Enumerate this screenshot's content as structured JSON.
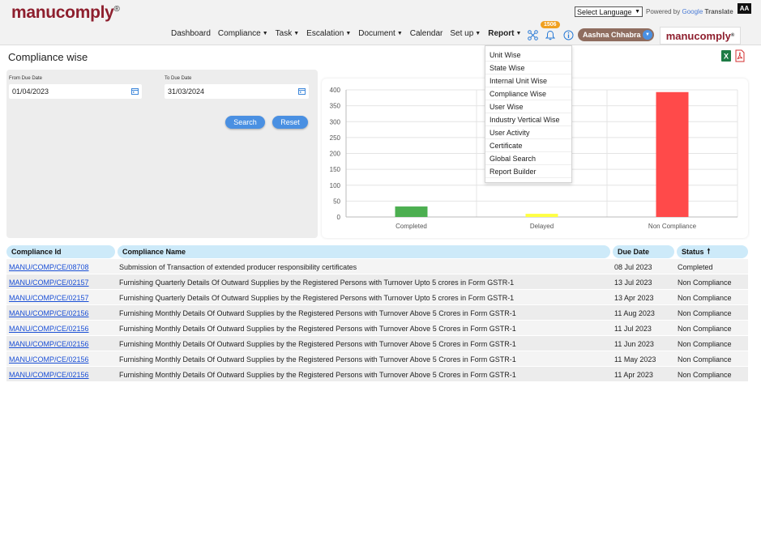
{
  "header": {
    "logo": "manucomply",
    "logo_reg": "®",
    "language_select": "Select Language",
    "powered_by": "Powered by",
    "google": "Google",
    "translate": "Translate",
    "aa": "AA",
    "notification_count": "1506",
    "user_name": "Aashna Chhabra",
    "brand_logo": "manucomply"
  },
  "nav": {
    "items": [
      {
        "label": "Dashboard"
      },
      {
        "label": "Compliance"
      },
      {
        "label": "Task"
      },
      {
        "label": "Escalation"
      },
      {
        "label": "Document"
      },
      {
        "label": "Calendar"
      },
      {
        "label": "Set up"
      },
      {
        "label": "Report"
      }
    ]
  },
  "icons": {
    "network": "network-icon",
    "bell": "bell-icon",
    "info": "info-icon",
    "excel": "excel-icon",
    "pdf": "pdf-icon",
    "calendar": "calendar-icon"
  },
  "page": {
    "title": "Compliance wise"
  },
  "filters": {
    "from_label": "From Due Date",
    "from_value": "01/04/2023",
    "to_label": "To Due Date",
    "to_value": "31/03/2024",
    "search_label": "Search",
    "reset_label": "Reset"
  },
  "report_menu": {
    "items": [
      "Unit Wise",
      "State Wise",
      "Internal Unit Wise",
      "Compliance Wise",
      "User Wise",
      "Industry Vertical Wise",
      "User Activity",
      "Certificate",
      "Global Search",
      "Report Builder"
    ]
  },
  "chart_data": {
    "type": "bar",
    "categories": [
      "Completed",
      "Delayed",
      "Non Compliance"
    ],
    "values": [
      33,
      10,
      393
    ],
    "colors": [
      "#4caf50",
      "#ffff44",
      "#ff4a4a"
    ],
    "ylim": [
      0,
      400
    ],
    "yticks": [
      0,
      50,
      100,
      150,
      200,
      250,
      300,
      350,
      400
    ],
    "grid": true
  },
  "table": {
    "headers": {
      "id": "Compliance Id",
      "name": "Compliance Name",
      "due": "Due Date",
      "status": "Status",
      "sort_arrow": "🠕"
    },
    "rows": [
      {
        "id": "MANU/COMP/CE/08708",
        "name": "Submission of Transaction of extended producer responsibility certificates",
        "due": "08 Jul 2023",
        "status": "Completed"
      },
      {
        "id": "MANU/COMP/CE/02157",
        "name": "Furnishing Quarterly Details Of Outward Supplies by the Registered Persons with Turnover Upto 5 crores in Form GSTR-1",
        "due": "13 Jul 2023",
        "status": "Non Compliance"
      },
      {
        "id": "MANU/COMP/CE/02157",
        "name": "Furnishing Quarterly Details Of Outward Supplies by the Registered Persons with Turnover Upto 5 crores in Form GSTR-1",
        "due": "13 Apr 2023",
        "status": "Non Compliance"
      },
      {
        "id": "MANU/COMP/CE/02156",
        "name": "Furnishing Monthly Details Of Outward Supplies by the Registered Persons with Turnover Above 5 Crores in Form GSTR-1",
        "due": "11 Aug 2023",
        "status": "Non Compliance"
      },
      {
        "id": "MANU/COMP/CE/02156",
        "name": "Furnishing Monthly Details Of Outward Supplies by the Registered Persons with Turnover Above 5 Crores in Form GSTR-1",
        "due": "11 Jul 2023",
        "status": "Non Compliance"
      },
      {
        "id": "MANU/COMP/CE/02156",
        "name": "Furnishing Monthly Details Of Outward Supplies by the Registered Persons with Turnover Above 5 Crores in Form GSTR-1",
        "due": "11 Jun 2023",
        "status": "Non Compliance"
      },
      {
        "id": "MANU/COMP/CE/02156",
        "name": "Furnishing Monthly Details Of Outward Supplies by the Registered Persons with Turnover Above 5 Crores in Form GSTR-1",
        "due": "11 May 2023",
        "status": "Non Compliance"
      },
      {
        "id": "MANU/COMP/CE/02156",
        "name": "Furnishing Monthly Details Of Outward Supplies by the Registered Persons with Turnover Above 5 Crores in Form GSTR-1",
        "due": "11 Apr 2023",
        "status": "Non Compliance"
      }
    ]
  }
}
